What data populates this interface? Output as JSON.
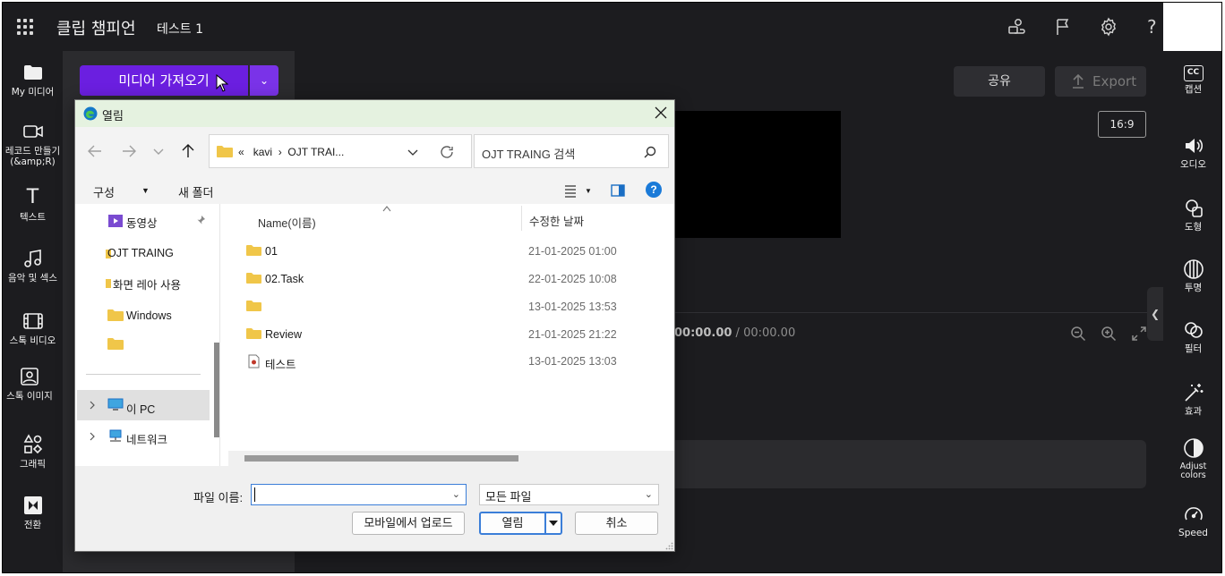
{
  "app": {
    "title": "클립 챔피언",
    "project_name": "테스트 1",
    "colors": {
      "accent": "#6b1fe0",
      "background": "#1c1c1f",
      "panel": "#2b2b2e"
    }
  },
  "topbar": {
    "icons": [
      "apps-grid-icon",
      "share-people-icon",
      "flag-icon",
      "gear-icon",
      "help-icon"
    ],
    "help_glyph": "?"
  },
  "left_rail": {
    "items": [
      {
        "label": "My 미디어",
        "icon": "folder-icon"
      },
      {
        "label": "레코드 만들기(&amp;R)",
        "icon": "camera-icon"
      },
      {
        "label": "텍스트",
        "icon": "text-icon",
        "glyph": "T"
      },
      {
        "label": "음악 및 섹스",
        "icon": "music-icon"
      },
      {
        "label": "스톡 비디오",
        "icon": "film-icon"
      },
      {
        "label": "스톡 이미지",
        "icon": "image-icon"
      },
      {
        "label": "그래픽",
        "icon": "shapes-icon"
      },
      {
        "label": "전환",
        "icon": "transition-icon"
      }
    ]
  },
  "library": {
    "import_label": "미디어 가져오기"
  },
  "header_actions": {
    "share_label": "공유",
    "export_label": "Export"
  },
  "preview": {
    "aspect_ratio": "16:9",
    "time_current": "00:00.00",
    "time_separator": " / ",
    "time_total": "00:00.00"
  },
  "right_rail": {
    "items": [
      {
        "label": "캡션",
        "icon": "captions-icon",
        "glyph": "CC"
      },
      {
        "label": "오디오",
        "icon": "speaker-icon"
      },
      {
        "label": "도형",
        "icon": "shape-icon"
      },
      {
        "label": "투명",
        "icon": "transparency-icon"
      },
      {
        "label": "필터",
        "icon": "filter-icon"
      },
      {
        "label": "효과",
        "icon": "magic-wand-icon"
      },
      {
        "label": "Adjust colors",
        "icon": "contrast-icon"
      },
      {
        "label": "Speed",
        "icon": "speedometer-icon"
      }
    ]
  },
  "dialog": {
    "title": "열림",
    "address": {
      "prefix": "«",
      "segment1": "kavi",
      "separator": "›",
      "segment2": "OJT TRAI..."
    },
    "search_placeholder": "OJT TRAING 검색",
    "toolbar": {
      "organize": "구성",
      "new_folder": "새 폴더",
      "help_glyph": "?"
    },
    "nav_pane": {
      "items": [
        {
          "label": "동영상",
          "icon": "video-folder-icon"
        },
        {
          "label": "OJT TRAING",
          "icon": "folder-icon"
        },
        {
          "label": "화면 레아 사용",
          "icon": "folder-icon"
        },
        {
          "label": "Windows",
          "icon": "folder-icon"
        },
        {
          "label": "",
          "icon": "folder-icon"
        },
        {
          "label": "이 PC",
          "icon": "pc-icon"
        },
        {
          "label": "네트워크",
          "icon": "network-icon"
        }
      ]
    },
    "columns": {
      "name": "Name(이름)",
      "date": "수정한 날짜"
    },
    "files": [
      {
        "name": "01",
        "date": "21-01-2025 01:00",
        "icon": "folder-icon"
      },
      {
        "name": "02.Task",
        "date": "22-01-2025 10:08",
        "icon": "folder-icon"
      },
      {
        "name": "",
        "date": "13-01-2025 13:53",
        "icon": "folder-icon"
      },
      {
        "name": "Review",
        "date": "21-01-2025 21:22",
        "icon": "folder-icon"
      },
      {
        "name": "테스트",
        "date": "13-01-2025 13:03",
        "icon": "project-file-icon"
      }
    ],
    "filename_label": "파일 이름:",
    "filename_value": "",
    "filetype": "모든 파일",
    "buttons": {
      "mobile_upload": "모바일에서 업로드",
      "open": "열림",
      "cancel": "취소"
    }
  }
}
